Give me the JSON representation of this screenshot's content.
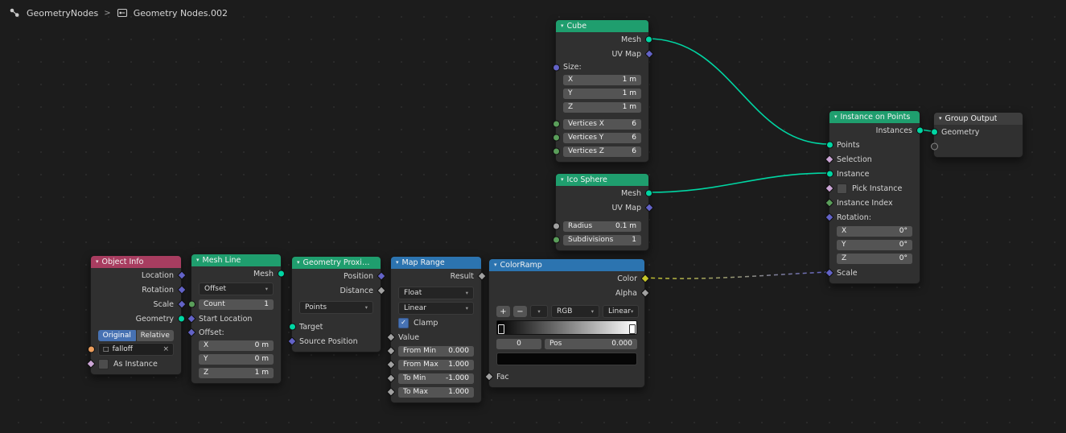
{
  "breadcrumb": {
    "tree_name": "GeometryNodes",
    "separator": ">",
    "datablock_name": "Geometry Nodes.002"
  },
  "icons": {
    "collapse": "▾",
    "dropdown": "▾",
    "check": "✓",
    "close": "×",
    "add": "+",
    "remove": "−",
    "specials": "▾",
    "object": "□"
  },
  "colors": {
    "socket_geometry": "#00d6a3",
    "socket_vector": "#6363c7",
    "socket_float": "#a1a1a1",
    "socket_color": "#c7c729",
    "socket_boolean": "#cca6d6",
    "socket_integer": "#5a9e5a",
    "socket_object": "#ed9e5c",
    "header_geometry": "#1f9e6e",
    "header_input": "#a83d60",
    "header_converter": "#2c74b0",
    "header_output": "#3e3e3e",
    "accent": "#4772b3"
  },
  "nodes": {
    "cube": {
      "title": "Cube",
      "out_mesh": "Mesh",
      "out_uvmap": "UV Map",
      "size_label": "Size:",
      "size": [
        {
          "axis": "X",
          "value": "1 m"
        },
        {
          "axis": "Y",
          "value": "1 m"
        },
        {
          "axis": "Z",
          "value": "1 m"
        }
      ],
      "vertices": [
        {
          "label": "Vertices X",
          "value": "6"
        },
        {
          "label": "Vertices Y",
          "value": "6"
        },
        {
          "label": "Vertices Z",
          "value": "6"
        }
      ]
    },
    "ico_sphere": {
      "title": "Ico Sphere",
      "out_mesh": "Mesh",
      "out_uvmap": "UV Map",
      "radius_label": "Radius",
      "radius_value": "0.1 m",
      "subdivisions_label": "Subdivisions",
      "subdivisions_value": "1"
    },
    "instance_on_points": {
      "title": "Instance on Points",
      "out_instances": "Instances",
      "in_points": "Points",
      "in_selection": "Selection",
      "in_instance": "Instance",
      "in_pick_instance": "Pick Instance",
      "in_instance_index": "Instance Index",
      "rotation_label": "Rotation:",
      "rotation": [
        {
          "axis": "X",
          "value": "0°"
        },
        {
          "axis": "Y",
          "value": "0°"
        },
        {
          "axis": "Z",
          "value": "0°"
        }
      ],
      "in_scale": "Scale"
    },
    "group_output": {
      "title": "Group Output",
      "in_geometry": "Geometry"
    },
    "object_info": {
      "title": "Object Info",
      "out_location": "Location",
      "out_rotation": "Rotation",
      "out_scale": "Scale",
      "out_geometry": "Geometry",
      "btn_original": "Original",
      "btn_relative": "Relative",
      "object_value": "falloff",
      "in_as_instance": "As Instance"
    },
    "mesh_line": {
      "title": "Mesh Line",
      "out_mesh": "Mesh",
      "mode_dropdown": "Offset",
      "count_label": "Count",
      "count_value": "1",
      "in_start_location": "Start Location",
      "offset_label": "Offset:",
      "offset": [
        {
          "axis": "X",
          "value": "0 m"
        },
        {
          "axis": "Y",
          "value": "0 m"
        },
        {
          "axis": "Z",
          "value": "1 m"
        }
      ]
    },
    "geometry_proximity": {
      "title": "Geometry Proximity",
      "out_position": "Position",
      "out_distance": "Distance",
      "mode_dropdown": "Points",
      "in_target": "Target",
      "in_source_position": "Source Position"
    },
    "map_range": {
      "title": "Map Range",
      "out_result": "Result",
      "data_type_dropdown": "Float",
      "interpolation_dropdown": "Linear",
      "clamp_label": "Clamp",
      "in_value": "Value",
      "fields": [
        {
          "label": "From Min",
          "value": "0.000"
        },
        {
          "label": "From Max",
          "value": "1.000"
        },
        {
          "label": "To Min",
          "value": "-1.000"
        },
        {
          "label": "To Max",
          "value": "1.000"
        }
      ]
    },
    "color_ramp": {
      "title": "ColorRamp",
      "out_color": "Color",
      "out_alpha": "Alpha",
      "color_mode_dropdown": "RGB",
      "interpolation_dropdown": "Linear",
      "index_value": "0",
      "pos_label": "Pos",
      "pos_value": "0.000",
      "in_fac": "Fac"
    }
  }
}
